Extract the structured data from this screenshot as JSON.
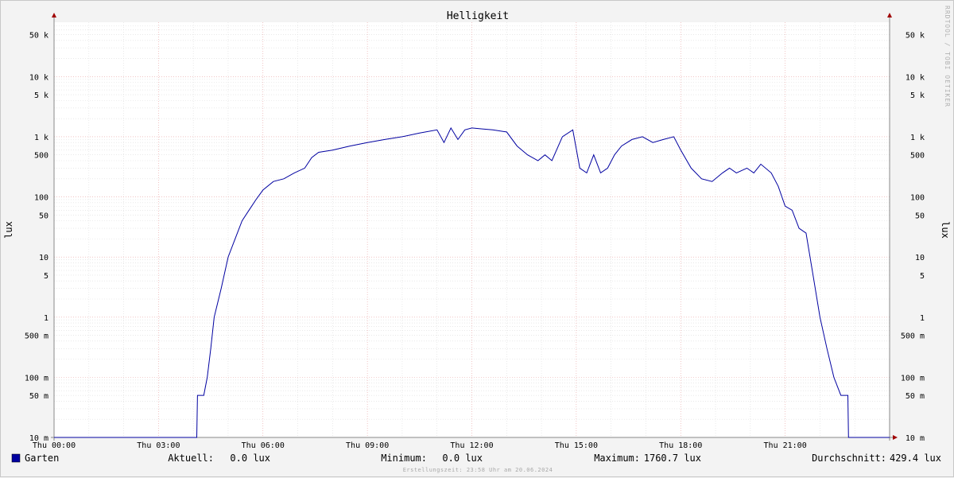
{
  "chart_data": {
    "type": "line",
    "title": "Helligkeit",
    "ylabel": "lux",
    "y_scale": "log",
    "ylim": [
      0.01,
      80000
    ],
    "xlim": [
      0,
      24
    ],
    "x_ticks": [
      {
        "v": 0,
        "label": "Thu 00:00"
      },
      {
        "v": 3,
        "label": "Thu 03:00"
      },
      {
        "v": 6,
        "label": "Thu 06:00"
      },
      {
        "v": 9,
        "label": "Thu 09:00"
      },
      {
        "v": 12,
        "label": "Thu 12:00"
      },
      {
        "v": 15,
        "label": "Thu 15:00"
      },
      {
        "v": 18,
        "label": "Thu 18:00"
      },
      {
        "v": 21,
        "label": "Thu 21:00"
      }
    ],
    "y_ticks": [
      {
        "v": 50000,
        "label": "50 k"
      },
      {
        "v": 10000,
        "label": "10 k"
      },
      {
        "v": 5000,
        "label": "5 k"
      },
      {
        "v": 1000,
        "label": "1 k"
      },
      {
        "v": 500,
        "label": "500"
      },
      {
        "v": 100,
        "label": "100"
      },
      {
        "v": 50,
        "label": "50"
      },
      {
        "v": 10,
        "label": "10"
      },
      {
        "v": 5,
        "label": "5"
      },
      {
        "v": 1,
        "label": "1"
      },
      {
        "v": 0.5,
        "label": "500 m"
      },
      {
        "v": 0.1,
        "label": "100 m"
      },
      {
        "v": 0.05,
        "label": "50 m"
      },
      {
        "v": 0.01,
        "label": "10 m"
      }
    ],
    "grid": true,
    "series": [
      {
        "name": "Garten",
        "color": "#0000a0",
        "points": [
          [
            0,
            0.01
          ],
          [
            4.1,
            0.01
          ],
          [
            4.12,
            0.05
          ],
          [
            4.3,
            0.05
          ],
          [
            4.4,
            0.1
          ],
          [
            4.5,
            0.3
          ],
          [
            4.6,
            1
          ],
          [
            4.8,
            3
          ],
          [
            5.0,
            10
          ],
          [
            5.2,
            20
          ],
          [
            5.4,
            40
          ],
          [
            5.6,
            60
          ],
          [
            5.8,
            90
          ],
          [
            6.0,
            130
          ],
          [
            6.3,
            180
          ],
          [
            6.6,
            200
          ],
          [
            6.9,
            250
          ],
          [
            7.2,
            300
          ],
          [
            7.4,
            450
          ],
          [
            7.6,
            550
          ],
          [
            8.0,
            600
          ],
          [
            8.5,
            700
          ],
          [
            9.0,
            800
          ],
          [
            9.5,
            900
          ],
          [
            10.0,
            1000
          ],
          [
            10.5,
            1150
          ],
          [
            11.0,
            1300
          ],
          [
            11.2,
            800
          ],
          [
            11.4,
            1400
          ],
          [
            11.6,
            900
          ],
          [
            11.8,
            1300
          ],
          [
            12.0,
            1400
          ],
          [
            12.3,
            1350
          ],
          [
            12.6,
            1300
          ],
          [
            13.0,
            1200
          ],
          [
            13.3,
            700
          ],
          [
            13.6,
            500
          ],
          [
            13.9,
            400
          ],
          [
            14.1,
            500
          ],
          [
            14.3,
            400
          ],
          [
            14.6,
            1000
          ],
          [
            14.9,
            1300
          ],
          [
            15.1,
            300
          ],
          [
            15.3,
            250
          ],
          [
            15.5,
            500
          ],
          [
            15.7,
            250
          ],
          [
            15.9,
            300
          ],
          [
            16.1,
            500
          ],
          [
            16.3,
            700
          ],
          [
            16.6,
            900
          ],
          [
            16.9,
            1000
          ],
          [
            17.2,
            800
          ],
          [
            17.5,
            900
          ],
          [
            17.8,
            1000
          ],
          [
            18.0,
            600
          ],
          [
            18.3,
            300
          ],
          [
            18.6,
            200
          ],
          [
            18.9,
            180
          ],
          [
            19.2,
            250
          ],
          [
            19.4,
            300
          ],
          [
            19.6,
            250
          ],
          [
            19.9,
            300
          ],
          [
            20.1,
            250
          ],
          [
            20.3,
            350
          ],
          [
            20.6,
            250
          ],
          [
            20.8,
            150
          ],
          [
            21.0,
            70
          ],
          [
            21.2,
            60
          ],
          [
            21.4,
            30
          ],
          [
            21.6,
            25
          ],
          [
            21.8,
            5
          ],
          [
            22.0,
            1
          ],
          [
            22.2,
            0.3
          ],
          [
            22.4,
            0.1
          ],
          [
            22.6,
            0.05
          ],
          [
            22.8,
            0.05
          ],
          [
            22.82,
            0.01
          ],
          [
            24,
            0.01
          ]
        ]
      }
    ]
  },
  "watermark": "RRDTOOL / TOBI OETIKER",
  "legend": {
    "series_name": "Garten",
    "aktuell_label": "Aktuell:",
    "aktuell_value": "0.0 lux",
    "minimum_label": "Minimum:",
    "minimum_value": "0.0 lux",
    "maximum_label": "Maximum:",
    "maximum_value": "1760.7 lux",
    "durchschnitt_label": "Durchschnitt:",
    "durchschnitt_value": "429.4 lux"
  },
  "footer": "Erstellungszeit: 23:58 Uhr am 20.06.2024"
}
